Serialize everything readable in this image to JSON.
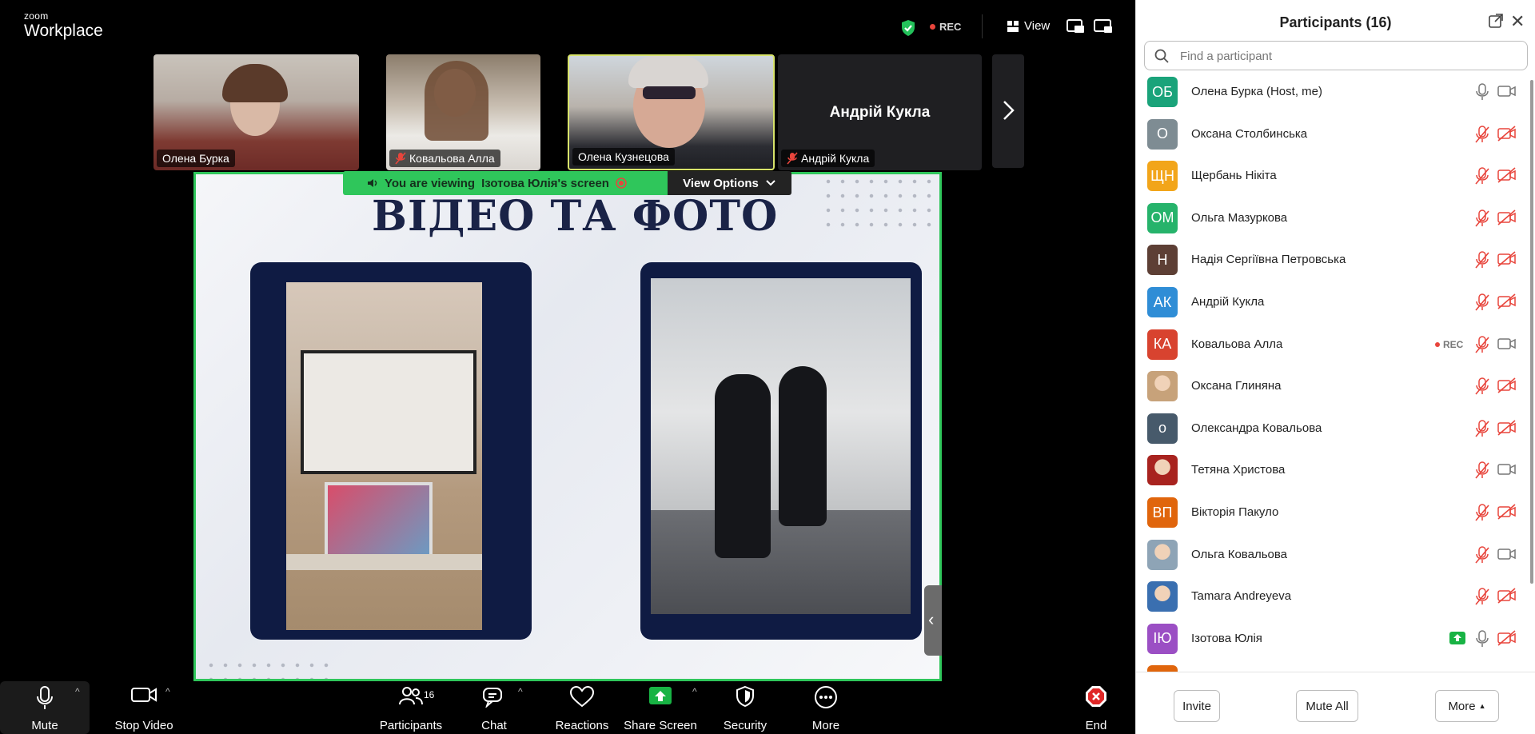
{
  "app": {
    "brand_small": "zoom",
    "brand_large": "Workplace"
  },
  "topbar": {
    "rec_label": "REC",
    "view_label": "View"
  },
  "thumbnails": [
    {
      "name": "Олена Бурка",
      "muted": false
    },
    {
      "name": "Ковальова Алла",
      "muted": true
    },
    {
      "name": "Олена Кузнецова",
      "muted": false
    },
    {
      "name": "Андрій Кукла",
      "muted": true,
      "big_name": "Андрій Кукла"
    }
  ],
  "share": {
    "banner_prefix": "You are viewing",
    "banner_owner": "Ізотова Юлія's screen",
    "view_options": "View Options",
    "slide_title": "ВІДЕО ТА ФОТО"
  },
  "toolbar": {
    "mute": "Mute",
    "stop_video": "Stop Video",
    "participants": "Participants",
    "participants_count": "16",
    "chat": "Chat",
    "reactions": "Reactions",
    "share_screen": "Share Screen",
    "security": "Security",
    "more": "More",
    "end": "End"
  },
  "panel": {
    "title": "Participants (16)",
    "search_placeholder": "Find a participant",
    "participants": [
      {
        "initials": "ОБ",
        "name": "Олена Бурка (Host, me)",
        "color": "#1aa37a",
        "mic": "on",
        "cam": "on"
      },
      {
        "initials": "О",
        "name": "Оксана Столбинська",
        "color": "#7e8c93",
        "mic": "off",
        "cam": "off"
      },
      {
        "initials": "ЩН",
        "name": "Щербань Нікіта",
        "color": "#f2a51a",
        "mic": "off",
        "cam": "off"
      },
      {
        "initials": "ОМ",
        "name": "Ольга Мазуркова",
        "color": "#26b36b",
        "mic": "off",
        "cam": "off"
      },
      {
        "initials": "Н",
        "name": "Надія Сергіївна Петровська",
        "color": "#5d3f35",
        "mic": "off",
        "cam": "off"
      },
      {
        "initials": "АК",
        "name": "Андрій Кукла",
        "color": "#2f8dd6",
        "mic": "off",
        "cam": "off"
      },
      {
        "initials": "КА",
        "name": "Ковальова Алла",
        "color": "#d8432f",
        "mic": "off",
        "cam": "on",
        "rec": "REC"
      },
      {
        "initials": "",
        "name": "Оксана Глиняна",
        "color": "#c7a27a",
        "mic": "off",
        "cam": "off",
        "photo": true
      },
      {
        "initials": "о",
        "name": "Олександра Ковальова",
        "color": "#475a6b",
        "mic": "off",
        "cam": "off"
      },
      {
        "initials": "",
        "name": "Тетяна Христова",
        "color": "#a8231f",
        "mic": "off",
        "cam": "on",
        "photo": true
      },
      {
        "initials": "ВП",
        "name": "Вікторія Пакуло",
        "color": "#e0650c",
        "mic": "off",
        "cam": "off"
      },
      {
        "initials": "",
        "name": "Ольга Ковальова",
        "color": "#8ea4b6",
        "mic": "off",
        "cam": "on",
        "photo": true
      },
      {
        "initials": "",
        "name": "Tamara Andreyeva",
        "color": "#3a6fb0",
        "mic": "off",
        "cam": "off",
        "photo": true
      },
      {
        "initials": "ІЮ",
        "name": "Ізотова Юлія",
        "color": "#9b4fc4",
        "mic": "on",
        "cam": "off",
        "sharing": true
      }
    ],
    "invite": "Invite",
    "mute_all": "Mute All",
    "more": "More"
  }
}
